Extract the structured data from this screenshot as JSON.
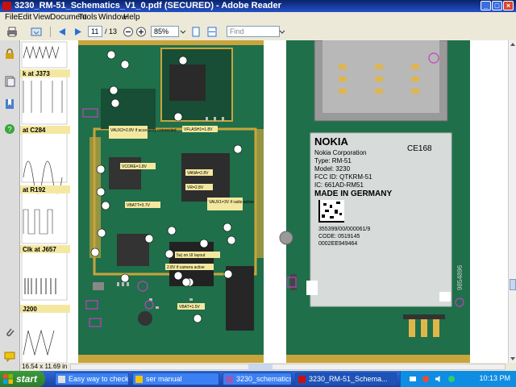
{
  "window": {
    "title": "3230_RM-51_Schematics_V1_0.pdf (SECURED) - Adobe Reader"
  },
  "menu": [
    "File",
    "Edit",
    "View",
    "Document",
    "Tools",
    "Window",
    "Help"
  ],
  "toolbar": {
    "page_current": "11",
    "page_total": "/ 13",
    "zoom": "85%",
    "find_placeholder": "Find"
  },
  "document": {
    "left_strip_labels": [
      "k at J373",
      "at C284",
      "at R192",
      "Clk at J657",
      "J200"
    ],
    "pcb_labels": {
      "vaux2": "VAUX2=2.8V if accessory connected",
      "vflash": "VFLASH1=1.8V",
      "vcore": "VCORE=1.8V",
      "vana": "VANA=2.8V",
      "vr": "VR=2.8V",
      "vaux1": "VAUX1=3V if radio active",
      "vbatt": "VBATT=3.7V",
      "camera": "2.8V if camera active",
      "layout": "5a) on UI layout",
      "vbat2": "VBAT=1.5V"
    },
    "label_sticker": {
      "brand": "NOKIA",
      "ce": "CE168",
      "corp": "Nokia Corporation",
      "type": "Type: RM-51",
      "model": "Model: 3230",
      "fcc": "FCC ID: QTKRM-51",
      "ic": "IC: 661AD-RM51",
      "made": "MADE IN GERMANY",
      "serial1": "355399/00/000061/9",
      "code": "CODE: 0519145",
      "serial2": "0002EE949464",
      "vertical": "9854896"
    }
  },
  "status_bar": {
    "page_size": "16.54 x 11.69 in"
  },
  "taskbar": {
    "start": "start",
    "tasks": [
      "Easy way to check sh...",
      "ser manual",
      "3230_schematics.rar ...",
      "3230_RM-51_Schema..."
    ],
    "clock": "10:13 PM"
  },
  "colors": {
    "pcb_green": "#1f6f4a",
    "pcb_gold": "#c8a43c",
    "label_yellow": "#f4e8a0",
    "title_blue": "#0a246a",
    "taskbar_blue": "#245edb"
  }
}
